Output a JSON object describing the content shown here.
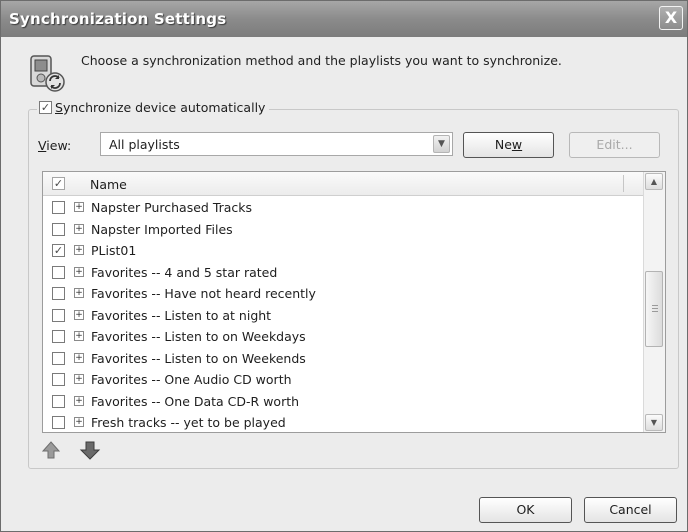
{
  "window": {
    "title": "Synchronization Settings",
    "close_label": "X"
  },
  "header": {
    "instructions": "Choose a synchronization method and the playlists you want to synchronize."
  },
  "sync": {
    "auto_label_accel": "S",
    "auto_label_rest": "ynchronize device automatically",
    "auto_checked": true
  },
  "view": {
    "label_accel": "V",
    "label_rest": "iew:",
    "selected": "All playlists",
    "arrow": "▼"
  },
  "buttons": {
    "new_pre": "Ne",
    "new_accel": "w",
    "edit": "Edit...",
    "ok": "OK",
    "cancel": "Cancel"
  },
  "list": {
    "header_checked": true,
    "column_name": "Name",
    "expander": "+",
    "items": [
      {
        "name": "Napster Purchased Tracks",
        "checked": false
      },
      {
        "name": "Napster Imported Files",
        "checked": false
      },
      {
        "name": "PList01",
        "checked": true
      },
      {
        "name": "Favorites -- 4 and 5 star rated",
        "checked": false
      },
      {
        "name": "Favorites -- Have not heard recently",
        "checked": false
      },
      {
        "name": "Favorites -- Listen to at night",
        "checked": false
      },
      {
        "name": "Favorites -- Listen to on Weekdays",
        "checked": false
      },
      {
        "name": "Favorites -- Listen to on Weekends",
        "checked": false
      },
      {
        "name": "Favorites -- One Audio CD worth",
        "checked": false
      },
      {
        "name": "Favorites -- One Data CD-R worth",
        "checked": false
      },
      {
        "name": "Fresh tracks -- yet to be played",
        "checked": false
      }
    ]
  },
  "scrollbar": {
    "up": "▲",
    "down": "▼"
  },
  "icons": {
    "device": "sync-device-icon",
    "move_up": "arrow-up-icon",
    "move_down": "arrow-down-icon"
  }
}
